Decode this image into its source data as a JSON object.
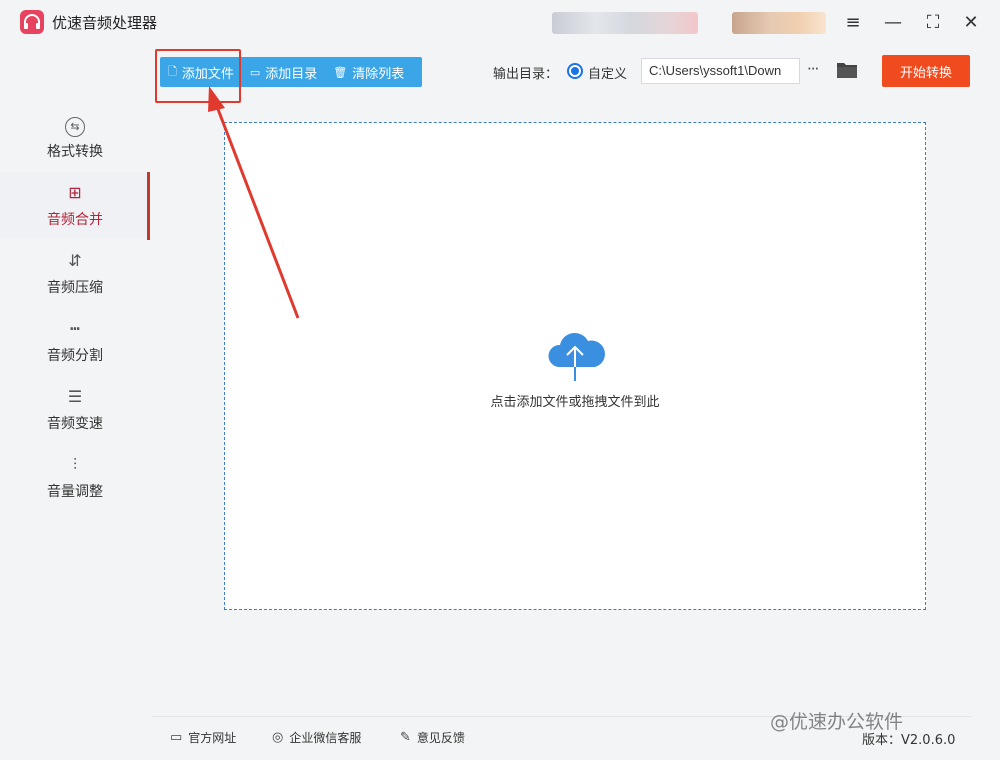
{
  "app": {
    "title": "优速音频处理器"
  },
  "window_controls": {
    "menu": "≡",
    "minimize": "—",
    "maximize": "⛶",
    "close": "✕"
  },
  "sidebar": {
    "items": [
      {
        "label": "格式转换",
        "icon": "format-convert-icon",
        "glyph": "⇆",
        "active": false
      },
      {
        "label": "音频合并",
        "icon": "audio-merge-icon",
        "glyph": "⊞",
        "active": true
      },
      {
        "label": "音频压缩",
        "icon": "audio-compress-icon",
        "glyph": "⇵",
        "active": false
      },
      {
        "label": "音频分割",
        "icon": "audio-split-icon",
        "glyph": "┅",
        "active": false
      },
      {
        "label": "音频变速",
        "icon": "audio-speed-icon",
        "glyph": "☰",
        "active": false
      },
      {
        "label": "音量调整",
        "icon": "volume-adjust-icon",
        "glyph": "⫶",
        "active": false
      }
    ]
  },
  "toolbar": {
    "add_file": "添加文件",
    "add_dir": "添加目录",
    "clear_list": "清除列表"
  },
  "output": {
    "label": "输出目录：",
    "option_label": "自定义",
    "path": "C:\\Users\\yssoft1\\Down",
    "more": "···"
  },
  "start_button": "开始转换",
  "drop_zone": {
    "hint": "点击添加文件或拖拽文件到此"
  },
  "footer": {
    "site": "官方网址",
    "wechat": "企业微信客服",
    "feedback": "意见反馈",
    "version": "版本：V2.0.6.0"
  },
  "watermark": "@优速办公软件",
  "colors": {
    "accent": "#3aa6e8",
    "start": "#ef4b1f",
    "active_nav": "#b2253a",
    "annotation": "#e03a2f"
  }
}
